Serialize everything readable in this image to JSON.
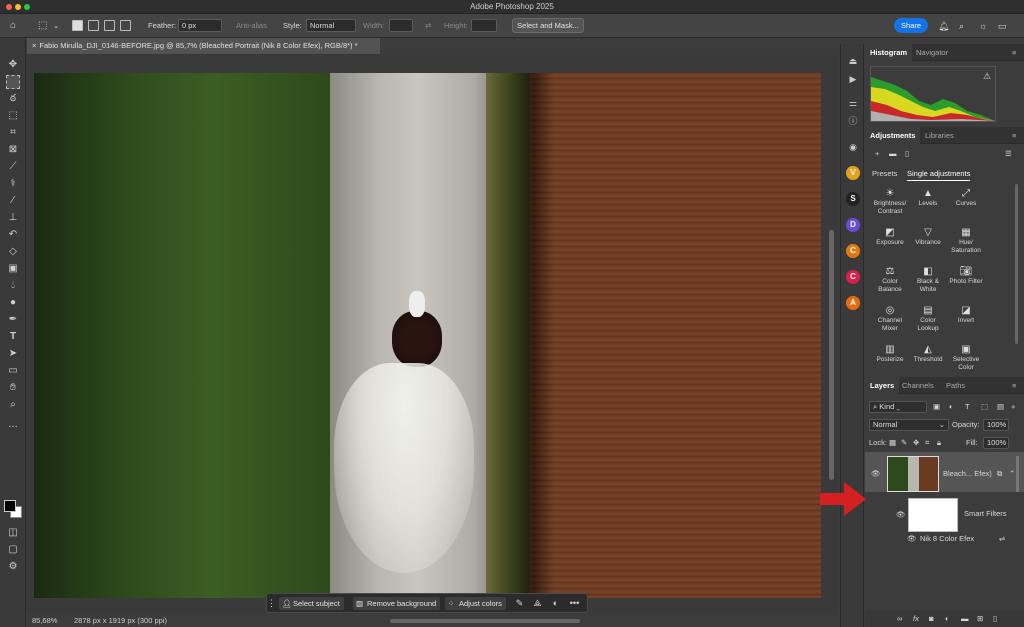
{
  "window": {
    "title": "Adobe Photoshop 2025"
  },
  "options": {
    "feather_label": "Feather:",
    "feather_value": "0 px",
    "antialias_label": "Anti-alias",
    "style_label": "Style:",
    "style_value": "Normal",
    "width_label": "Width:",
    "height_label": "Height:",
    "select_mask": "Select and Mask...",
    "share": "Share"
  },
  "document": {
    "tab": "Fabio Mirulla_DJI_0146-BEFORE.jpg @ 85,7% (Bleached Portrait (Nik 8 Color Efex), RGB/8*) *"
  },
  "status": {
    "zoom": "85,68%",
    "size": "2878 px x 1919 px (300 ppi)"
  },
  "context_bar": {
    "select_subject": "Select subject",
    "remove_background": "Remove background",
    "adjust_colors": "Adjust colors"
  },
  "panels": {
    "top_tabs": [
      "Histogram",
      "Navigator"
    ],
    "adj_tabs": [
      "Adjustments",
      "Libraries"
    ],
    "adj_subtabs": [
      "Presets",
      "Single adjustments"
    ],
    "adjustments": [
      [
        "Brightness/",
        "Contrast"
      ],
      [
        "Levels",
        ""
      ],
      [
        "Curves",
        ""
      ],
      [
        "Exposure",
        ""
      ],
      [
        "Vibrance",
        ""
      ],
      [
        "Hue/",
        "Saturation"
      ],
      [
        "Color",
        "Balance"
      ],
      [
        "Black &",
        "White"
      ],
      [
        "Photo Filter",
        ""
      ],
      [
        "Channel",
        "Mixer"
      ],
      [
        "Color",
        "Lookup"
      ],
      [
        "Invert",
        ""
      ],
      [
        "Posterize",
        ""
      ],
      [
        "Threshold",
        ""
      ],
      [
        "Selective",
        "Color"
      ]
    ],
    "layer_tabs": [
      "Layers",
      "Channels",
      "Paths"
    ],
    "kind": "Kind",
    "blend": "Normal",
    "opacity_label": "Opacity:",
    "opacity_value": "100%",
    "lock_label": "Lock:",
    "fill_label": "Fill:",
    "fill_value": "100%",
    "layer_name": "Bleach... Efex)",
    "smart_filters": "Smart Filters",
    "filter_name": "Nik 8 Color Efex"
  },
  "colors": {
    "accent": "#1473e6",
    "arrow": "#d42020"
  }
}
